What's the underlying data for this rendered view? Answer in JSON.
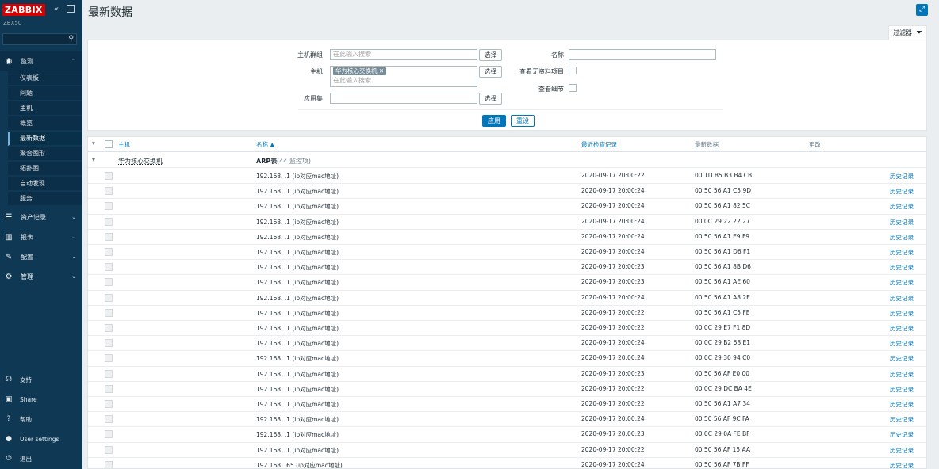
{
  "sidebar": {
    "logo": "ZABBIX",
    "server_name": "ZBX50",
    "menu": {
      "monitoring": "监测",
      "inventory": "资产记录",
      "reports": "报表",
      "configuration": "配置",
      "administration": "管理"
    },
    "submenu": [
      "仪表板",
      "问题",
      "主机",
      "概览",
      "最新数据",
      "聚合图形",
      "拓扑图",
      "自动发现",
      "服务"
    ],
    "bottom": {
      "support": "支持",
      "share": "Share",
      "help": "帮助",
      "user_settings": "User settings",
      "logout": "退出"
    }
  },
  "page": {
    "title": "最新数据"
  },
  "filter": {
    "tab_label": "过滤器",
    "host_groups_label": "主机群组",
    "host_groups_placeholder": "在此输入搜索",
    "hosts_label": "主机",
    "host_chip": "华为核心交换机",
    "hosts_placeholder": "在此输入搜索",
    "application_label": "应用集",
    "select_label": "选择",
    "name_label": "名称",
    "show_items_without_data_label": "查看无资料项目",
    "show_details_label": "查看细节",
    "apply_label": "应用",
    "reset_label": "重设"
  },
  "table": {
    "headers": {
      "host": "主机",
      "name": "名称 ▲",
      "last_check": "最近检查记录",
      "last_value": "最新数据",
      "change": "更改"
    },
    "group": {
      "host": "华为核心交换机",
      "application": "ARP表",
      "count": "(44 监控项)"
    },
    "history_label": "历史记录",
    "rows": [
      {
        "name": "192.168.  .1 (ip对应mac地址)",
        "last_check": "2020-09-17 20:00:22",
        "last_value": "00 1D B5 B3 B4 CB"
      },
      {
        "name": "192.168.  .1 (ip对应mac地址)",
        "last_check": "2020-09-17 20:00:24",
        "last_value": "00 50 56 A1 C5 9D"
      },
      {
        "name": "192.168.  .1 (ip对应mac地址)",
        "last_check": "2020-09-17 20:00:24",
        "last_value": "00 50 56 A1 82 5C"
      },
      {
        "name": "192.168.  .1 (ip对应mac地址)",
        "last_check": "2020-09-17 20:00:24",
        "last_value": "00 0C 29 22 22 27"
      },
      {
        "name": "192.168.  .1 (ip对应mac地址)",
        "last_check": "2020-09-17 20:00:24",
        "last_value": "00 50 56 A1 E9 F9"
      },
      {
        "name": "192.168.  .1 (ip对应mac地址)",
        "last_check": "2020-09-17 20:00:24",
        "last_value": "00 50 56 A1 D6 F1"
      },
      {
        "name": "192.168.  .1 (ip对应mac地址)",
        "last_check": "2020-09-17 20:00:23",
        "last_value": "00 50 56 A1 8B D6"
      },
      {
        "name": "192.168.  .1 (ip对应mac地址)",
        "last_check": "2020-09-17 20:00:23",
        "last_value": "00 50 56 A1 AE 60"
      },
      {
        "name": "192.168.  .1 (ip对应mac地址)",
        "last_check": "2020-09-17 20:00:24",
        "last_value": "00 50 56 A1 A8 2E"
      },
      {
        "name": "192.168.  .1 (ip对应mac地址)",
        "last_check": "2020-09-17 20:00:22",
        "last_value": "00 50 56 A1 C5 FE"
      },
      {
        "name": "192.168.  .1 (ip对应mac地址)",
        "last_check": "2020-09-17 20:00:22",
        "last_value": "00 0C 29 E7 F1 8D"
      },
      {
        "name": "192.168.  .1 (ip对应mac地址)",
        "last_check": "2020-09-17 20:00:24",
        "last_value": "00 0C 29 B2 68 E1"
      },
      {
        "name": "192.168.  .1 (ip对应mac地址)",
        "last_check": "2020-09-17 20:00:24",
        "last_value": "00 0C 29 30 94 C0"
      },
      {
        "name": "192.168.  .1 (ip对应mac地址)",
        "last_check": "2020-09-17 20:00:23",
        "last_value": "00 50 56 AF E0 00"
      },
      {
        "name": "192.168.  .1 (ip对应mac地址)",
        "last_check": "2020-09-17 20:00:22",
        "last_value": "00 0C 29 DC BA 4E"
      },
      {
        "name": "192.168.  .1 (ip对应mac地址)",
        "last_check": "2020-09-17 20:00:22",
        "last_value": "00 50 56 A1 A7 34"
      },
      {
        "name": "192.168.  .1 (ip对应mac地址)",
        "last_check": "2020-09-17 20:00:24",
        "last_value": "00 50 56 AF 9C FA"
      },
      {
        "name": "192.168.  .1 (ip对应mac地址)",
        "last_check": "2020-09-17 20:00:23",
        "last_value": "00 0C 29 0A FE BF"
      },
      {
        "name": "192.168.  .1 (ip对应mac地址)",
        "last_check": "2020-09-17 20:00:22",
        "last_value": "00 50 56 AF 15 AA"
      },
      {
        "name": "192.168.  .65 (ip对应mac地址)",
        "last_check": "2020-09-17 20:00:24",
        "last_value": "00 50 56 AF 7B FF"
      }
    ]
  },
  "colors": {
    "sidebar": "#0e3853",
    "accent": "#0275b8",
    "logo": "#d40000"
  }
}
